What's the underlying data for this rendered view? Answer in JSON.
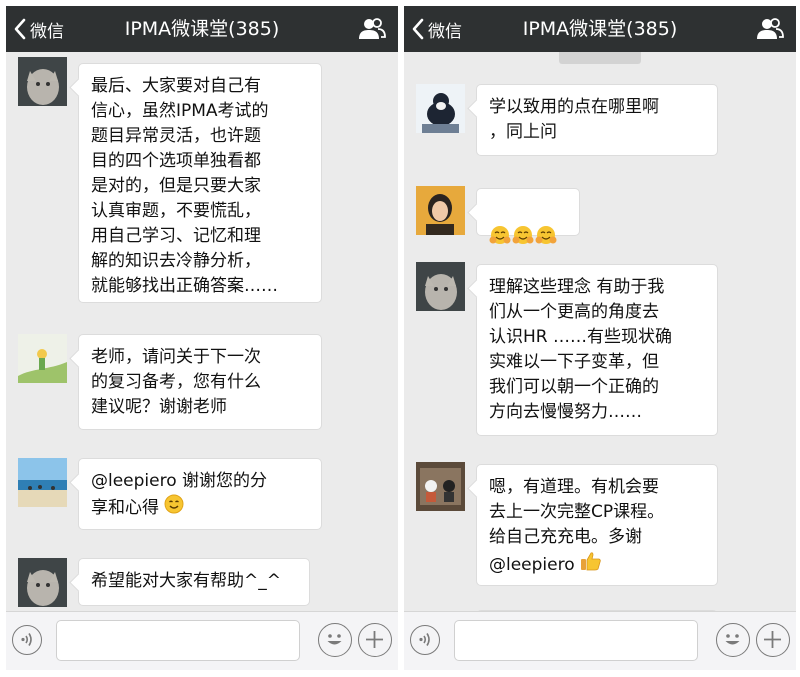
{
  "header": {
    "back_label": "微信",
    "title": "IPMA微课堂(385)"
  },
  "left_panel": {
    "messages": [
      {
        "text": "最后、大家要对自己有\n信心，虽然IPMA考试的\n题目异常灵活，也许题\n目的四个选项单独看都\n是对的，但是只要大家\n认真审题，不要慌乱，\n用自己学习、记忆和理\n解的知识去冷静分析，\n就能够找出正确答案……"
      },
      {
        "text": "老师，请问关于下一次\n的复习备考，您有什么\n建议呢？谢谢老师"
      },
      {
        "text": "@leepiero  谢谢您的分\n享和心得",
        "emoji": "smiling-face-emoji"
      },
      {
        "text": "希望能对大家有帮助^_^"
      }
    ]
  },
  "right_panel": {
    "messages": [
      {
        "text": "学以致用的点在哪里啊\n，同上问"
      },
      {
        "text": "",
        "emoji": "hugging-face-emoji x3"
      },
      {
        "text": "理解这些理念 有助于我\n们从一个更高的角度去\n认识HR ……有些现状确\n实难以一下子变革，但\n我们可以朝一个正确的\n方向去慢慢努力……"
      },
      {
        "text": "嗯，有道理。有机会要\n去上一次完整CP课程。\n给自己充充电。多谢\n@leepiero",
        "emoji": "thumbs-up-emoji"
      }
    ]
  },
  "icons": {
    "back": "chevron-left-icon",
    "group": "group-people-icon",
    "voice": "voice-icon",
    "emoji": "smiley-icon",
    "plus": "plus-icon"
  },
  "colors": {
    "topbar": "#2e3132",
    "chat_bg": "#ebebeb",
    "bubble": "#ffffff",
    "bottombar": "#f4f4f6"
  }
}
